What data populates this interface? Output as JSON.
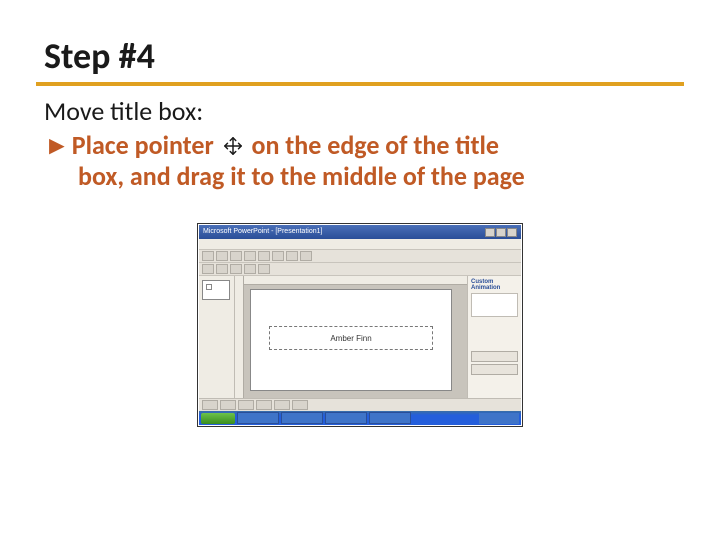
{
  "title": "Step #4",
  "subhead": "Move title box:",
  "bullet": {
    "glyph": "►",
    "line1_before": "Place pointer",
    "line1_after": "on the edge of the title",
    "line2": "box, and drag it to the middle of the page"
  },
  "screenshot": {
    "app_title": "Microsoft PowerPoint - [Presentation1]",
    "taskpane_title": "Custom Animation",
    "title_box_text": "Amber Finn"
  }
}
